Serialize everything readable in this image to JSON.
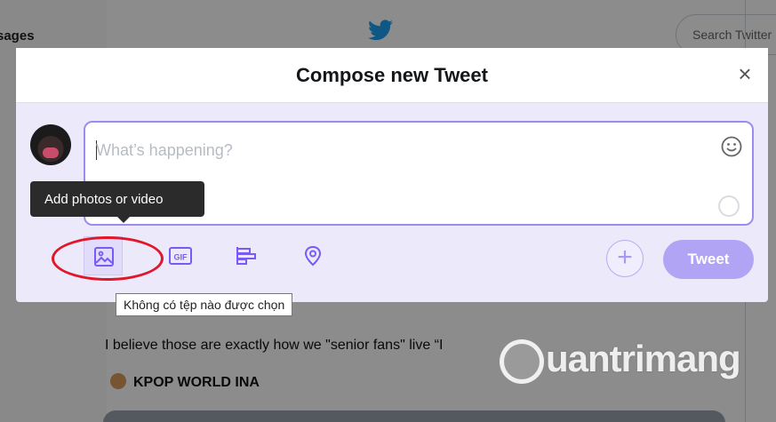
{
  "background": {
    "sidebar_partial_label": "sages",
    "search_placeholder": "Search Twitter",
    "tweet_text": "I believe those are exactly how we \"senior fans\" live “I",
    "author_name": "KPOP WORLD INA",
    "bird_icon": "twitter-bird-icon"
  },
  "modal": {
    "title": "Compose new Tweet",
    "close_label": "×",
    "compose": {
      "placeholder": "What’s happening?",
      "value": ""
    },
    "tooltips": {
      "add_media": "Add photos or video",
      "file_input": "Không có tệp nào được chọn"
    },
    "toolbar": {
      "icons": [
        "image-icon",
        "gif-icon",
        "poll-icon",
        "location-icon"
      ],
      "gif_label": "GIF",
      "add_label": "+",
      "tweet_label": "Tweet"
    }
  },
  "watermark": {
    "text": "uantrimang"
  },
  "colors": {
    "accent": "#7a5af5",
    "tweet_button_disabled": "#b1a4f4",
    "annotation_red": "#e0162b",
    "modal_bg": "#ece9fb"
  }
}
